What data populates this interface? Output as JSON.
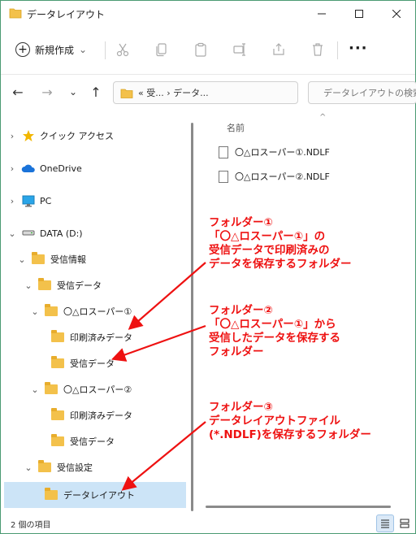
{
  "window": {
    "title": "データレイアウト"
  },
  "toolbar": {
    "new_label": "新規作成",
    "new_caret": "⌄",
    "more_label": "···"
  },
  "navbar": {
    "back": "←",
    "forward": "→",
    "history": "⌄",
    "up": "↑",
    "address_text": "«  受...  ›  データ...",
    "address_chevron": "⌄",
    "refresh": "↻",
    "search_placeholder": "データレイアウトの検索"
  },
  "sidebar": {
    "items": [
      {
        "label": "クイック アクセス",
        "chevron": "›"
      },
      {
        "label": "OneDrive",
        "chevron": "›"
      },
      {
        "label": "PC",
        "chevron": "›"
      },
      {
        "label": "DATA (D:)",
        "chevron": "⌄"
      },
      {
        "label": "受信情報",
        "chevron": "⌄"
      },
      {
        "label": "受信データ",
        "chevron": "⌄"
      },
      {
        "label": "〇△ロスーパー①",
        "chevron": "⌄"
      },
      {
        "label": "印刷済みデータ",
        "chevron": ""
      },
      {
        "label": "受信データ",
        "chevron": ""
      },
      {
        "label": "〇△ロスーパー②",
        "chevron": "⌄"
      },
      {
        "label": "印刷済みデータ",
        "chevron": ""
      },
      {
        "label": "受信データ",
        "chevron": ""
      },
      {
        "label": "受信設定",
        "chevron": "⌄"
      },
      {
        "label": "データレイアウト",
        "chevron": ""
      }
    ]
  },
  "content": {
    "column_name": "名前",
    "files": [
      {
        "name": "〇△ロスーパー①.NDLF"
      },
      {
        "name": "〇△ロスーパー②.NDLF"
      }
    ]
  },
  "status": {
    "count_text": "2 個の項目"
  },
  "annotations": {
    "note1": {
      "line1": "フォルダー①",
      "line2": "「〇△ロスーパー①」の",
      "line3": "受信データで印刷済みの",
      "line4": "データを保存するフォルダー"
    },
    "note2": {
      "line1": "フォルダー②",
      "line2": "「〇△ロスーパー①」から",
      "line3": "受信したデータを保存する",
      "line4": "フォルダー"
    },
    "note3": {
      "line1": "フォルダー③",
      "line2": "データレイアウトファイル",
      "line3": "(*.NDLF)を保存するフォルダー"
    }
  },
  "colors": {
    "annotation": "#ee1111",
    "selection": "#cce4f7",
    "folder": "#f3c14b"
  }
}
